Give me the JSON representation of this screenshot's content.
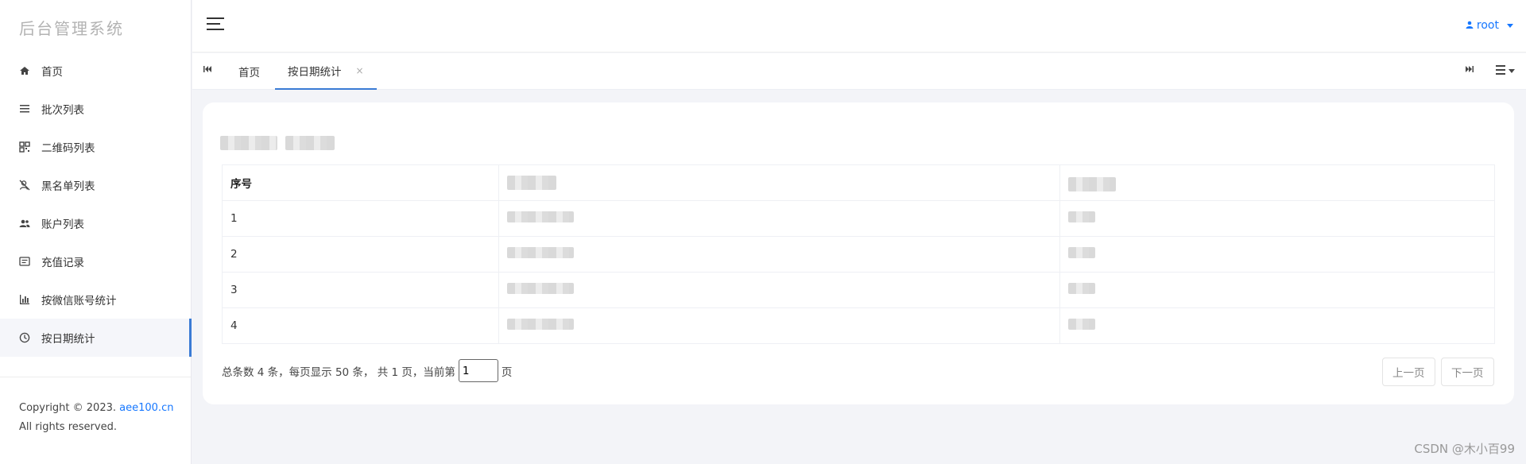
{
  "sidebar": {
    "brand": "后台管理系统",
    "items": [
      {
        "label": "首页",
        "icon": "home-icon"
      },
      {
        "label": "批次列表",
        "icon": "list-icon"
      },
      {
        "label": "二维码列表",
        "icon": "qrcode-icon"
      },
      {
        "label": "黑名单列表",
        "icon": "user-block-icon"
      },
      {
        "label": "账户列表",
        "icon": "users-icon"
      },
      {
        "label": "充值记录",
        "icon": "receipt-icon"
      },
      {
        "label": "按微信账号统计",
        "icon": "bar-chart-icon"
      },
      {
        "label": "按日期统计",
        "icon": "clock-icon",
        "active": true
      }
    ],
    "copyright": "Copyright © 2023.",
    "copyright_link": "aee100.cn",
    "rights": "All rights reserved."
  },
  "header": {
    "user": "root"
  },
  "tabs": {
    "items": [
      {
        "label": "首页"
      },
      {
        "label": "按日期统计",
        "active": true
      }
    ],
    "close_glyph": "×"
  },
  "table": {
    "headers": [
      "序号"
    ],
    "rows": [
      "1",
      "2",
      "3",
      "4"
    ]
  },
  "pager": {
    "summary": "总条数 4 条，每页显示 50 条， 共 1 页，当前第",
    "current_page": "1",
    "suffix": "页",
    "prev": "上一页",
    "next": "下一页"
  },
  "watermark": "CSDN @木小百99",
  "colors": {
    "accent": "#3a7bd5",
    "link": "#1677ff",
    "page_bg": "#f3f4f8"
  }
}
